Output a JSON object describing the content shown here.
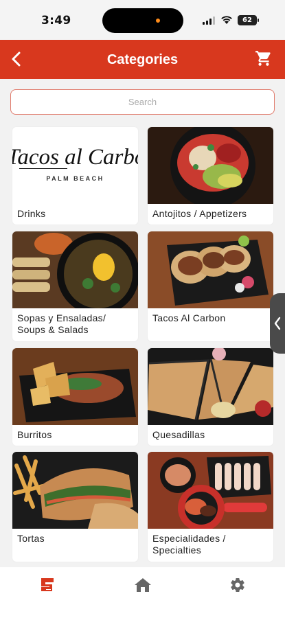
{
  "status_bar": {
    "time": "3:49",
    "battery": "62"
  },
  "header": {
    "title": "Categories",
    "back_icon": "chevron-left-icon",
    "cart_icon": "cart-icon"
  },
  "search": {
    "placeholder": "Search",
    "value": ""
  },
  "logo": {
    "text": "Tacos al Carbon",
    "subtext": "PALM BEACH"
  },
  "categories": [
    {
      "label": "Drinks"
    },
    {
      "label": "Antojitos / Appetizers"
    },
    {
      "label": "Sopas y Ensaladas/ Soups & Salads"
    },
    {
      "label": "Tacos Al Carbon"
    },
    {
      "label": "Burritos"
    },
    {
      "label": "Quesadillas"
    },
    {
      "label": "Tortas"
    },
    {
      "label": "Especialidades / Specialties"
    }
  ],
  "tab_bar": {
    "items": [
      {
        "icon": "menu-logo-icon",
        "active": true
      },
      {
        "icon": "home-icon"
      },
      {
        "icon": "gear-icon"
      }
    ]
  },
  "colors": {
    "brand_red": "#d8381e",
    "tab_active": "#d8381e",
    "tab_inactive": "#666666"
  }
}
